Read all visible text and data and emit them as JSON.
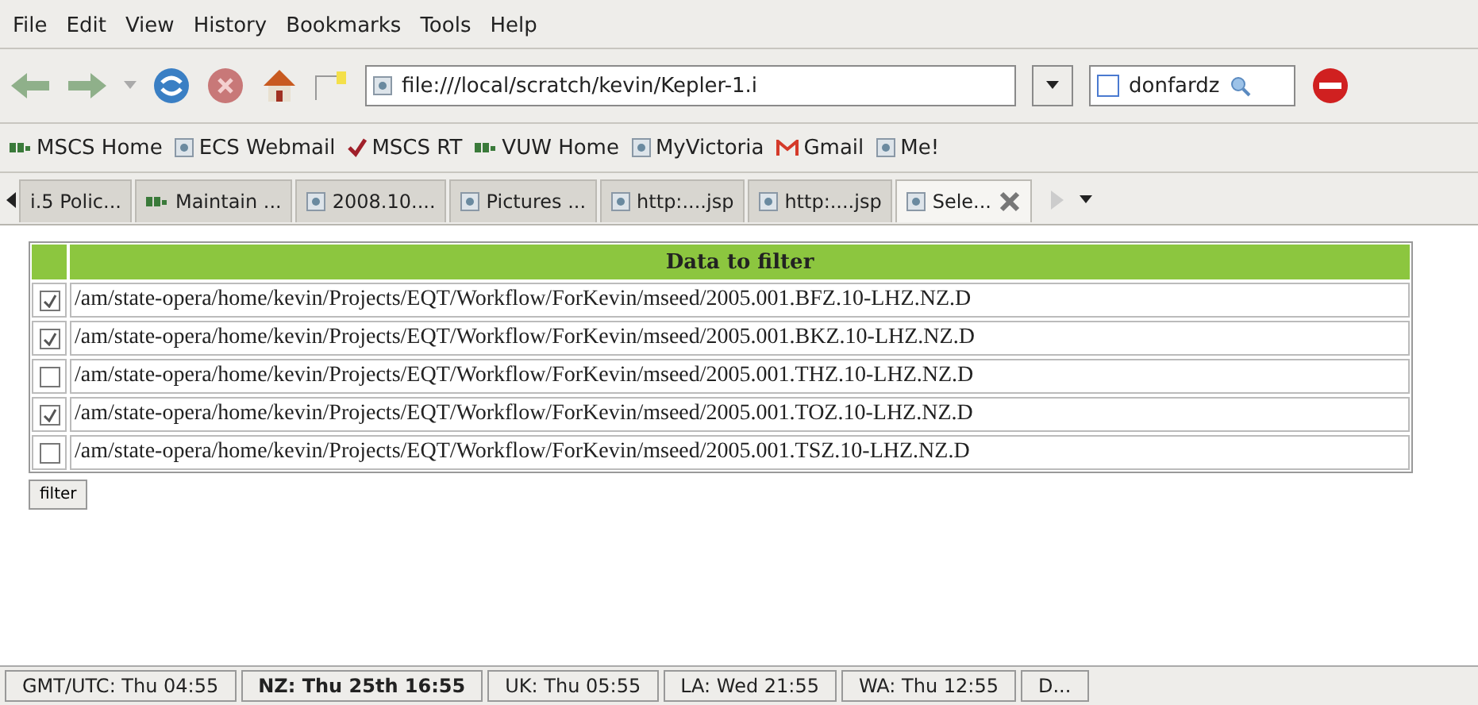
{
  "menu": [
    "File",
    "Edit",
    "View",
    "History",
    "Bookmarks",
    "Tools",
    "Help"
  ],
  "address": {
    "value": "file:///local/scratch/kevin/Kepler-1.i"
  },
  "search": {
    "value": "donfardz"
  },
  "bookmarks": [
    {
      "label": "MSCS Home",
      "kind": "dots"
    },
    {
      "label": "ECS Webmail",
      "kind": "page"
    },
    {
      "label": "MSCS RT",
      "kind": "check"
    },
    {
      "label": "VUW Home",
      "kind": "dots"
    },
    {
      "label": "MyVictoria",
      "kind": "page"
    },
    {
      "label": "Gmail",
      "kind": "mail"
    },
    {
      "label": "Me!",
      "kind": "page"
    }
  ],
  "tabs": [
    {
      "label": "i.5 Polic...",
      "kind": "none",
      "selected": false
    },
    {
      "label": "Maintain ...",
      "kind": "dots",
      "selected": false
    },
    {
      "label": "2008.10....",
      "kind": "page",
      "selected": false
    },
    {
      "label": "Pictures ...",
      "kind": "page",
      "selected": false
    },
    {
      "label": "http:....jsp",
      "kind": "page",
      "selected": false
    },
    {
      "label": "http:....jsp",
      "kind": "page",
      "selected": false
    },
    {
      "label": "Sele...",
      "kind": "page",
      "selected": true
    }
  ],
  "table": {
    "header": "Data to filter",
    "rows": [
      {
        "path": "/am/state-opera/home/kevin/Projects/EQT/Workflow/ForKevin/mseed/2005.001.BFZ.10-LHZ.NZ.D",
        "checked": true
      },
      {
        "path": "/am/state-opera/home/kevin/Projects/EQT/Workflow/ForKevin/mseed/2005.001.BKZ.10-LHZ.NZ.D",
        "checked": true
      },
      {
        "path": "/am/state-opera/home/kevin/Projects/EQT/Workflow/ForKevin/mseed/2005.001.THZ.10-LHZ.NZ.D",
        "checked": false
      },
      {
        "path": "/am/state-opera/home/kevin/Projects/EQT/Workflow/ForKevin/mseed/2005.001.TOZ.10-LHZ.NZ.D",
        "checked": true
      },
      {
        "path": "/am/state-opera/home/kevin/Projects/EQT/Workflow/ForKevin/mseed/2005.001.TSZ.10-LHZ.NZ.D",
        "checked": false
      }
    ]
  },
  "filter_button": "filter",
  "status_bar": [
    {
      "label": "GMT/UTC: Thu 04:55",
      "bold": false
    },
    {
      "label": "NZ: Thu 25th 16:55",
      "bold": true
    },
    {
      "label": "UK: Thu 05:55",
      "bold": false
    },
    {
      "label": "LA: Wed 21:55",
      "bold": false
    },
    {
      "label": "WA: Thu 12:55",
      "bold": false
    },
    {
      "label": "D...",
      "bold": false
    }
  ]
}
